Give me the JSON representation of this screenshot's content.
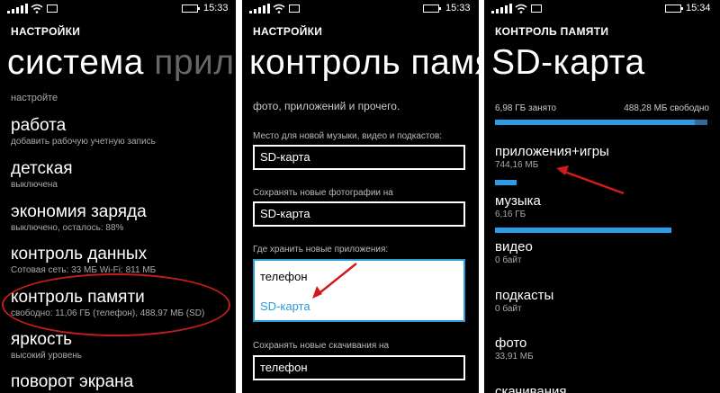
{
  "panel1": {
    "status": {
      "time": "15:33"
    },
    "header": "НАСТРОЙКИ",
    "pivot_active": "система",
    "pivot_next": "прило",
    "section_label": "настройте",
    "items": [
      {
        "title": "работа",
        "subtitle": "добавить рабочую учетную запись"
      },
      {
        "title": "детская",
        "subtitle": "выключена"
      },
      {
        "title": "экономия заряда",
        "subtitle": "выключено, осталось: 88%"
      },
      {
        "title": "контроль данных",
        "subtitle": "Сотовая сеть: 33 МБ Wi-Fi: 811 МБ"
      },
      {
        "title": "контроль памяти",
        "subtitle": "свободно: 11,06 ГБ (телефон), 488,97 МБ (SD)"
      },
      {
        "title": "яркость",
        "subtitle": "высокий уровень"
      },
      {
        "title": "поворот экрана",
        "subtitle": ""
      }
    ],
    "highlight_color": "#c41c1c"
  },
  "panel2": {
    "status": {
      "time": "15:33"
    },
    "header": "НАСТРОЙКИ",
    "pivot": "контроль памя",
    "intro_text": "фото, приложений и прочего.",
    "fields": [
      {
        "label": "Место для новой музыки, видео и подкастов:",
        "value": "SD-карта"
      },
      {
        "label": "Сохранять новые фотографии на",
        "value": "SD-карта"
      }
    ],
    "apps_field": {
      "label": "Где хранить новые приложения:",
      "options": [
        "телефон",
        "SD-карта"
      ],
      "selected": "SD-карта"
    },
    "download_field": {
      "label": "Сохранять новые скачивания на",
      "value": "телефон"
    },
    "accent": "#2e9ad6"
  },
  "panel3": {
    "status": {
      "time": "15:34"
    },
    "header": "КОНТРОЛЬ ПАМЯТИ",
    "pivot": "SD-карта",
    "used_label": "6,98 ГБ занято",
    "free_label": "488,28 МБ свободно",
    "used_fraction": 0.94,
    "categories": [
      {
        "title": "приложения+игры",
        "size": "744,16 МБ",
        "fraction": 0.1
      },
      {
        "title": "музыка",
        "size": "6,16 ГБ",
        "fraction": 0.83
      },
      {
        "title": "видео",
        "size": "0 байт",
        "fraction": 0
      },
      {
        "title": "подкасты",
        "size": "0 байт",
        "fraction": 0
      },
      {
        "title": "фото",
        "size": "33,91 МБ",
        "fraction": 0
      }
    ],
    "cut_item": "скачивания",
    "accent": "#2b9be3"
  }
}
